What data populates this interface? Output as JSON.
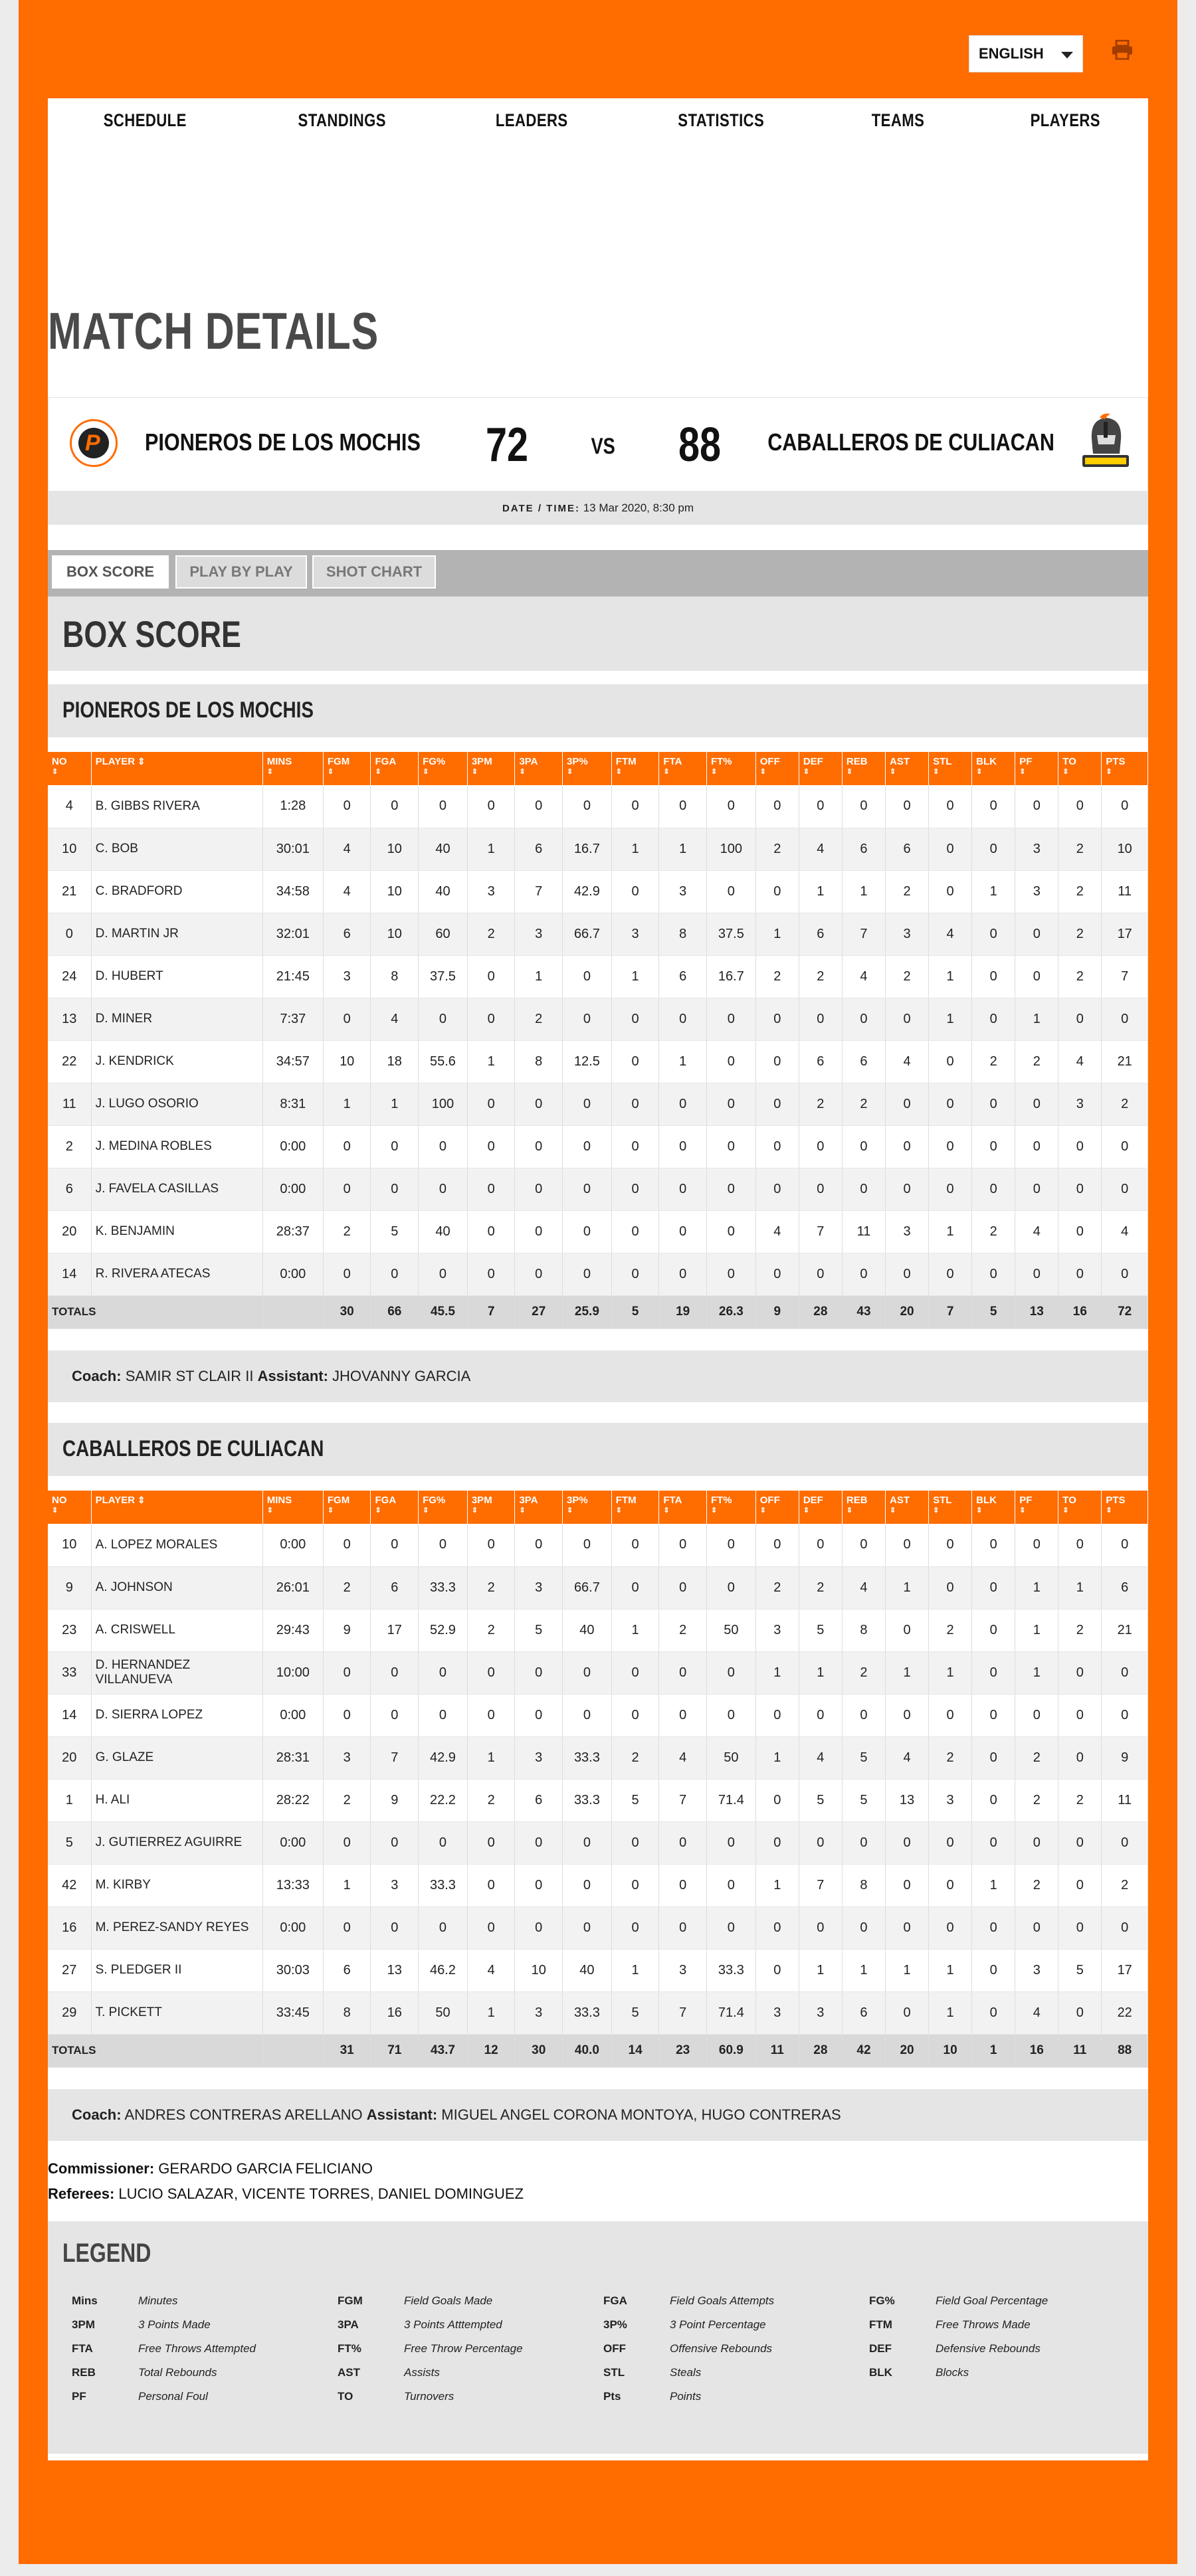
{
  "header": {
    "language": "ENGLISH",
    "nav": [
      "SCHEDULE",
      "STANDINGS",
      "LEADERS",
      "STATISTICS",
      "TEAMS",
      "PLAYERS"
    ]
  },
  "page_title": "MATCH DETAILS",
  "match": {
    "home_team": "PIONEROS DE LOS MOCHIS",
    "home_score": "72",
    "vs": "VS",
    "away_score": "88",
    "away_team": "CABALLEROS DE CULIACAN",
    "date_label": "DATE / TIME:",
    "date_value": "13 Mar 2020, 8:30 pm"
  },
  "tabs": [
    "BOX SCORE",
    "PLAY BY PLAY",
    "SHOT CHART"
  ],
  "box_score_title": "BOX SCORE",
  "columns": [
    "NO",
    "PLAYER",
    "MINS",
    "FGM",
    "FGA",
    "FG%",
    "3PM",
    "3PA",
    "3P%",
    "FTM",
    "FTA",
    "FT%",
    "OFF",
    "DEF",
    "REB",
    "AST",
    "STL",
    "BLK",
    "PF",
    "TO",
    "PTS"
  ],
  "totals_label": "TOTALS",
  "teams": [
    {
      "name": "PIONEROS DE LOS MOCHIS",
      "players": [
        [
          "4",
          "B. GIBBS RIVERA",
          "1:28",
          "0",
          "0",
          "0",
          "0",
          "0",
          "0",
          "0",
          "0",
          "0",
          "0",
          "0",
          "0",
          "0",
          "0",
          "0",
          "0",
          "0",
          "0"
        ],
        [
          "10",
          "C. BOB",
          "30:01",
          "4",
          "10",
          "40",
          "1",
          "6",
          "16.7",
          "1",
          "1",
          "100",
          "2",
          "4",
          "6",
          "6",
          "0",
          "0",
          "3",
          "2",
          "10"
        ],
        [
          "21",
          "C. BRADFORD",
          "34:58",
          "4",
          "10",
          "40",
          "3",
          "7",
          "42.9",
          "0",
          "3",
          "0",
          "0",
          "1",
          "1",
          "2",
          "0",
          "1",
          "3",
          "2",
          "11"
        ],
        [
          "0",
          "D. MARTIN JR",
          "32:01",
          "6",
          "10",
          "60",
          "2",
          "3",
          "66.7",
          "3",
          "8",
          "37.5",
          "1",
          "6",
          "7",
          "3",
          "4",
          "0",
          "0",
          "2",
          "17"
        ],
        [
          "24",
          "D. HUBERT",
          "21:45",
          "3",
          "8",
          "37.5",
          "0",
          "1",
          "0",
          "1",
          "6",
          "16.7",
          "2",
          "2",
          "4",
          "2",
          "1",
          "0",
          "0",
          "2",
          "7"
        ],
        [
          "13",
          "D. MINER",
          "7:37",
          "0",
          "4",
          "0",
          "0",
          "2",
          "0",
          "0",
          "0",
          "0",
          "0",
          "0",
          "0",
          "0",
          "1",
          "0",
          "1",
          "0",
          "0"
        ],
        [
          "22",
          "J. KENDRICK",
          "34:57",
          "10",
          "18",
          "55.6",
          "1",
          "8",
          "12.5",
          "0",
          "1",
          "0",
          "0",
          "6",
          "6",
          "4",
          "0",
          "2",
          "2",
          "4",
          "21"
        ],
        [
          "11",
          "J. LUGO OSORIO",
          "8:31",
          "1",
          "1",
          "100",
          "0",
          "0",
          "0",
          "0",
          "0",
          "0",
          "0",
          "2",
          "2",
          "0",
          "0",
          "0",
          "0",
          "3",
          "2"
        ],
        [
          "2",
          "J. MEDINA ROBLES",
          "0:00",
          "0",
          "0",
          "0",
          "0",
          "0",
          "0",
          "0",
          "0",
          "0",
          "0",
          "0",
          "0",
          "0",
          "0",
          "0",
          "0",
          "0",
          "0"
        ],
        [
          "6",
          "J. FAVELA CASILLAS",
          "0:00",
          "0",
          "0",
          "0",
          "0",
          "0",
          "0",
          "0",
          "0",
          "0",
          "0",
          "0",
          "0",
          "0",
          "0",
          "0",
          "0",
          "0",
          "0"
        ],
        [
          "20",
          "K. BENJAMIN",
          "28:37",
          "2",
          "5",
          "40",
          "0",
          "0",
          "0",
          "0",
          "0",
          "0",
          "4",
          "7",
          "11",
          "3",
          "1",
          "2",
          "4",
          "0",
          "4"
        ],
        [
          "14",
          "R. RIVERA ATECAS",
          "0:00",
          "0",
          "0",
          "0",
          "0",
          "0",
          "0",
          "0",
          "0",
          "0",
          "0",
          "0",
          "0",
          "0",
          "0",
          "0",
          "0",
          "0",
          "0"
        ]
      ],
      "totals": [
        "",
        "30",
        "66",
        "45.5",
        "7",
        "27",
        "25.9",
        "5",
        "19",
        "26.3",
        "9",
        "28",
        "43",
        "20",
        "7",
        "5",
        "13",
        "16",
        "72"
      ],
      "coach_label": "Coach:",
      "coach": "SAMIR ST CLAIR II",
      "assistant_label": "Assistant:",
      "assistant": "JHOVANNY GARCIA"
    },
    {
      "name": "CABALLEROS DE CULIACAN",
      "players": [
        [
          "10",
          "A. LOPEZ MORALES",
          "0:00",
          "0",
          "0",
          "0",
          "0",
          "0",
          "0",
          "0",
          "0",
          "0",
          "0",
          "0",
          "0",
          "0",
          "0",
          "0",
          "0",
          "0",
          "0"
        ],
        [
          "9",
          "A. JOHNSON",
          "26:01",
          "2",
          "6",
          "33.3",
          "2",
          "3",
          "66.7",
          "0",
          "0",
          "0",
          "2",
          "2",
          "4",
          "1",
          "0",
          "0",
          "1",
          "1",
          "6"
        ],
        [
          "23",
          "A. CRISWELL",
          "29:43",
          "9",
          "17",
          "52.9",
          "2",
          "5",
          "40",
          "1",
          "2",
          "50",
          "3",
          "5",
          "8",
          "0",
          "2",
          "0",
          "1",
          "2",
          "21"
        ],
        [
          "33",
          "D. HERNANDEZ VILLANUEVA",
          "10:00",
          "0",
          "0",
          "0",
          "0",
          "0",
          "0",
          "0",
          "0",
          "0",
          "1",
          "1",
          "2",
          "1",
          "1",
          "0",
          "1",
          "0",
          "0"
        ],
        [
          "14",
          "D. SIERRA LOPEZ",
          "0:00",
          "0",
          "0",
          "0",
          "0",
          "0",
          "0",
          "0",
          "0",
          "0",
          "0",
          "0",
          "0",
          "0",
          "0",
          "0",
          "0",
          "0",
          "0"
        ],
        [
          "20",
          "G. GLAZE",
          "28:31",
          "3",
          "7",
          "42.9",
          "1",
          "3",
          "33.3",
          "2",
          "4",
          "50",
          "1",
          "4",
          "5",
          "4",
          "2",
          "0",
          "2",
          "0",
          "9"
        ],
        [
          "1",
          "H. ALI",
          "28:22",
          "2",
          "9",
          "22.2",
          "2",
          "6",
          "33.3",
          "5",
          "7",
          "71.4",
          "0",
          "5",
          "5",
          "13",
          "3",
          "0",
          "2",
          "2",
          "11"
        ],
        [
          "5",
          "J. GUTIERREZ AGUIRRE",
          "0:00",
          "0",
          "0",
          "0",
          "0",
          "0",
          "0",
          "0",
          "0",
          "0",
          "0",
          "0",
          "0",
          "0",
          "0",
          "0",
          "0",
          "0",
          "0"
        ],
        [
          "42",
          "M. KIRBY",
          "13:33",
          "1",
          "3",
          "33.3",
          "0",
          "0",
          "0",
          "0",
          "0",
          "0",
          "1",
          "7",
          "8",
          "0",
          "0",
          "1",
          "2",
          "0",
          "2"
        ],
        [
          "16",
          "M. PEREZ-SANDY REYES",
          "0:00",
          "0",
          "0",
          "0",
          "0",
          "0",
          "0",
          "0",
          "0",
          "0",
          "0",
          "0",
          "0",
          "0",
          "0",
          "0",
          "0",
          "0",
          "0"
        ],
        [
          "27",
          "S. PLEDGER II",
          "30:03",
          "6",
          "13",
          "46.2",
          "4",
          "10",
          "40",
          "1",
          "3",
          "33.3",
          "0",
          "1",
          "1",
          "1",
          "1",
          "0",
          "3",
          "5",
          "17"
        ],
        [
          "29",
          "T. PICKETT",
          "33:45",
          "8",
          "16",
          "50",
          "1",
          "3",
          "33.3",
          "5",
          "7",
          "71.4",
          "3",
          "3",
          "6",
          "0",
          "1",
          "0",
          "4",
          "0",
          "22"
        ]
      ],
      "totals": [
        "",
        "31",
        "71",
        "43.7",
        "12",
        "30",
        "40.0",
        "14",
        "23",
        "60.9",
        "11",
        "28",
        "42",
        "20",
        "10",
        "1",
        "16",
        "11",
        "88"
      ],
      "coach_label": "Coach:",
      "coach": "ANDRES CONTRERAS ARELLANO",
      "assistant_label": "Assistant:",
      "assistant": "MIGUEL ANGEL CORONA MONTOYA, HUGO CONTRERAS"
    }
  ],
  "officials": {
    "commissioner_label": "Commissioner:",
    "commissioner": "GERARDO GARCIA FELICIANO",
    "referees_label": "Referees:",
    "referees": "LUCIO SALAZAR, VICENTE TORRES, DANIEL DOMINGUEZ"
  },
  "legend": {
    "title": "LEGEND",
    "items": [
      [
        "Mins",
        "Minutes"
      ],
      [
        "FGM",
        "Field Goals Made"
      ],
      [
        "FGA",
        "Field Goals Attempts"
      ],
      [
        "FG%",
        "Field Goal Percentage"
      ],
      [
        "3PM",
        "3 Points Made"
      ],
      [
        "3PA",
        "3 Points Atttempted"
      ],
      [
        "3P%",
        "3 Point Percentage"
      ],
      [
        "FTM",
        "Free Throws Made"
      ],
      [
        "FTA",
        "Free Throws Attempted"
      ],
      [
        "FT%",
        "Free Throw Percentage"
      ],
      [
        "OFF",
        "Offensive Rebounds"
      ],
      [
        "DEF",
        "Defensive Rebounds"
      ],
      [
        "REB",
        "Total Rebounds"
      ],
      [
        "AST",
        "Assists"
      ],
      [
        "STL",
        "Steals"
      ],
      [
        "BLK",
        "Blocks"
      ],
      [
        "PF",
        "Personal Foul"
      ],
      [
        "TO",
        "Turnovers"
      ],
      [
        "Pts",
        "Points"
      ]
    ]
  },
  "colors": {
    "brand": "#ff6c00",
    "panel": "#e5e5e5",
    "tabbar": "#b3b3b3"
  }
}
